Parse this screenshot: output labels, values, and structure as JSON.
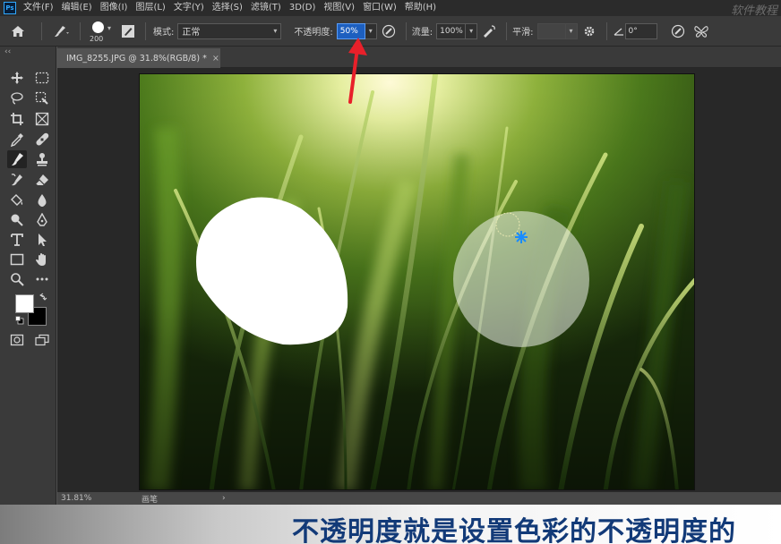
{
  "app": {
    "logo_text": "Ps",
    "watermark": "软件教程"
  },
  "menubar": {
    "items": [
      "文件(F)",
      "编辑(E)",
      "图像(I)",
      "图层(L)",
      "文字(Y)",
      "选择(S)",
      "滤镜(T)",
      "3D(D)",
      "视图(V)",
      "窗口(W)",
      "帮助(H)"
    ]
  },
  "options": {
    "brush_size": "200",
    "mode_label": "模式:",
    "mode_value": "正常",
    "opacity_label": "不透明度:",
    "opacity_value": "50%",
    "flow_label": "流量:",
    "flow_value": "100%",
    "smoothing_label": "平滑:",
    "smoothing_value": "",
    "angle_value": "0°"
  },
  "toolbar": {
    "collapse_glyph": "‹‹"
  },
  "document": {
    "tab_title": "IMG_8255.JPG @ 31.8%(RGB/8) *",
    "tab_close": "×"
  },
  "statusbar": {
    "zoom": "31.81%",
    "info": "画笔",
    "arrow": "›"
  },
  "subtitle": {
    "text": "不透明度就是设置色彩的不透明度的"
  },
  "colors": {
    "accent": "#31a8ff",
    "selected_field": "#1d5fbf",
    "annotation_arrow": "#e8202a",
    "subtitle_text": "#123a78"
  }
}
